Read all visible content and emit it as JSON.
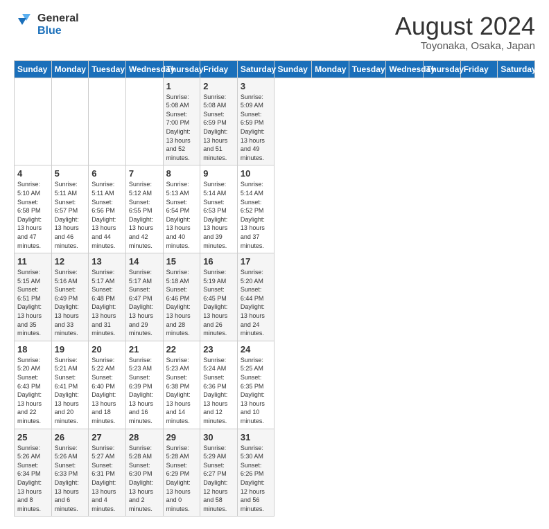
{
  "header": {
    "logo_line1": "General",
    "logo_line2": "Blue",
    "month": "August 2024",
    "location": "Toyonaka, Osaka, Japan"
  },
  "days_of_week": [
    "Sunday",
    "Monday",
    "Tuesday",
    "Wednesday",
    "Thursday",
    "Friday",
    "Saturday"
  ],
  "weeks": [
    [
      {
        "day": "",
        "content": ""
      },
      {
        "day": "",
        "content": ""
      },
      {
        "day": "",
        "content": ""
      },
      {
        "day": "",
        "content": ""
      },
      {
        "day": "1",
        "content": "Sunrise: 5:08 AM\nSunset: 7:00 PM\nDaylight: 13 hours\nand 52 minutes."
      },
      {
        "day": "2",
        "content": "Sunrise: 5:08 AM\nSunset: 6:59 PM\nDaylight: 13 hours\nand 51 minutes."
      },
      {
        "day": "3",
        "content": "Sunrise: 5:09 AM\nSunset: 6:59 PM\nDaylight: 13 hours\nand 49 minutes."
      }
    ],
    [
      {
        "day": "4",
        "content": "Sunrise: 5:10 AM\nSunset: 6:58 PM\nDaylight: 13 hours\nand 47 minutes."
      },
      {
        "day": "5",
        "content": "Sunrise: 5:11 AM\nSunset: 6:57 PM\nDaylight: 13 hours\nand 46 minutes."
      },
      {
        "day": "6",
        "content": "Sunrise: 5:11 AM\nSunset: 6:56 PM\nDaylight: 13 hours\nand 44 minutes."
      },
      {
        "day": "7",
        "content": "Sunrise: 5:12 AM\nSunset: 6:55 PM\nDaylight: 13 hours\nand 42 minutes."
      },
      {
        "day": "8",
        "content": "Sunrise: 5:13 AM\nSunset: 6:54 PM\nDaylight: 13 hours\nand 40 minutes."
      },
      {
        "day": "9",
        "content": "Sunrise: 5:14 AM\nSunset: 6:53 PM\nDaylight: 13 hours\nand 39 minutes."
      },
      {
        "day": "10",
        "content": "Sunrise: 5:14 AM\nSunset: 6:52 PM\nDaylight: 13 hours\nand 37 minutes."
      }
    ],
    [
      {
        "day": "11",
        "content": "Sunrise: 5:15 AM\nSunset: 6:51 PM\nDaylight: 13 hours\nand 35 minutes."
      },
      {
        "day": "12",
        "content": "Sunrise: 5:16 AM\nSunset: 6:49 PM\nDaylight: 13 hours\nand 33 minutes."
      },
      {
        "day": "13",
        "content": "Sunrise: 5:17 AM\nSunset: 6:48 PM\nDaylight: 13 hours\nand 31 minutes."
      },
      {
        "day": "14",
        "content": "Sunrise: 5:17 AM\nSunset: 6:47 PM\nDaylight: 13 hours\nand 29 minutes."
      },
      {
        "day": "15",
        "content": "Sunrise: 5:18 AM\nSunset: 6:46 PM\nDaylight: 13 hours\nand 28 minutes."
      },
      {
        "day": "16",
        "content": "Sunrise: 5:19 AM\nSunset: 6:45 PM\nDaylight: 13 hours\nand 26 minutes."
      },
      {
        "day": "17",
        "content": "Sunrise: 5:20 AM\nSunset: 6:44 PM\nDaylight: 13 hours\nand 24 minutes."
      }
    ],
    [
      {
        "day": "18",
        "content": "Sunrise: 5:20 AM\nSunset: 6:43 PM\nDaylight: 13 hours\nand 22 minutes."
      },
      {
        "day": "19",
        "content": "Sunrise: 5:21 AM\nSunset: 6:41 PM\nDaylight: 13 hours\nand 20 minutes."
      },
      {
        "day": "20",
        "content": "Sunrise: 5:22 AM\nSunset: 6:40 PM\nDaylight: 13 hours\nand 18 minutes."
      },
      {
        "day": "21",
        "content": "Sunrise: 5:23 AM\nSunset: 6:39 PM\nDaylight: 13 hours\nand 16 minutes."
      },
      {
        "day": "22",
        "content": "Sunrise: 5:23 AM\nSunset: 6:38 PM\nDaylight: 13 hours\nand 14 minutes."
      },
      {
        "day": "23",
        "content": "Sunrise: 5:24 AM\nSunset: 6:36 PM\nDaylight: 13 hours\nand 12 minutes."
      },
      {
        "day": "24",
        "content": "Sunrise: 5:25 AM\nSunset: 6:35 PM\nDaylight: 13 hours\nand 10 minutes."
      }
    ],
    [
      {
        "day": "25",
        "content": "Sunrise: 5:26 AM\nSunset: 6:34 PM\nDaylight: 13 hours\nand 8 minutes."
      },
      {
        "day": "26",
        "content": "Sunrise: 5:26 AM\nSunset: 6:33 PM\nDaylight: 13 hours\nand 6 minutes."
      },
      {
        "day": "27",
        "content": "Sunrise: 5:27 AM\nSunset: 6:31 PM\nDaylight: 13 hours\nand 4 minutes."
      },
      {
        "day": "28",
        "content": "Sunrise: 5:28 AM\nSunset: 6:30 PM\nDaylight: 13 hours\nand 2 minutes."
      },
      {
        "day": "29",
        "content": "Sunrise: 5:28 AM\nSunset: 6:29 PM\nDaylight: 13 hours\nand 0 minutes."
      },
      {
        "day": "30",
        "content": "Sunrise: 5:29 AM\nSunset: 6:27 PM\nDaylight: 12 hours\nand 58 minutes."
      },
      {
        "day": "31",
        "content": "Sunrise: 5:30 AM\nSunset: 6:26 PM\nDaylight: 12 hours\nand 56 minutes."
      }
    ]
  ]
}
